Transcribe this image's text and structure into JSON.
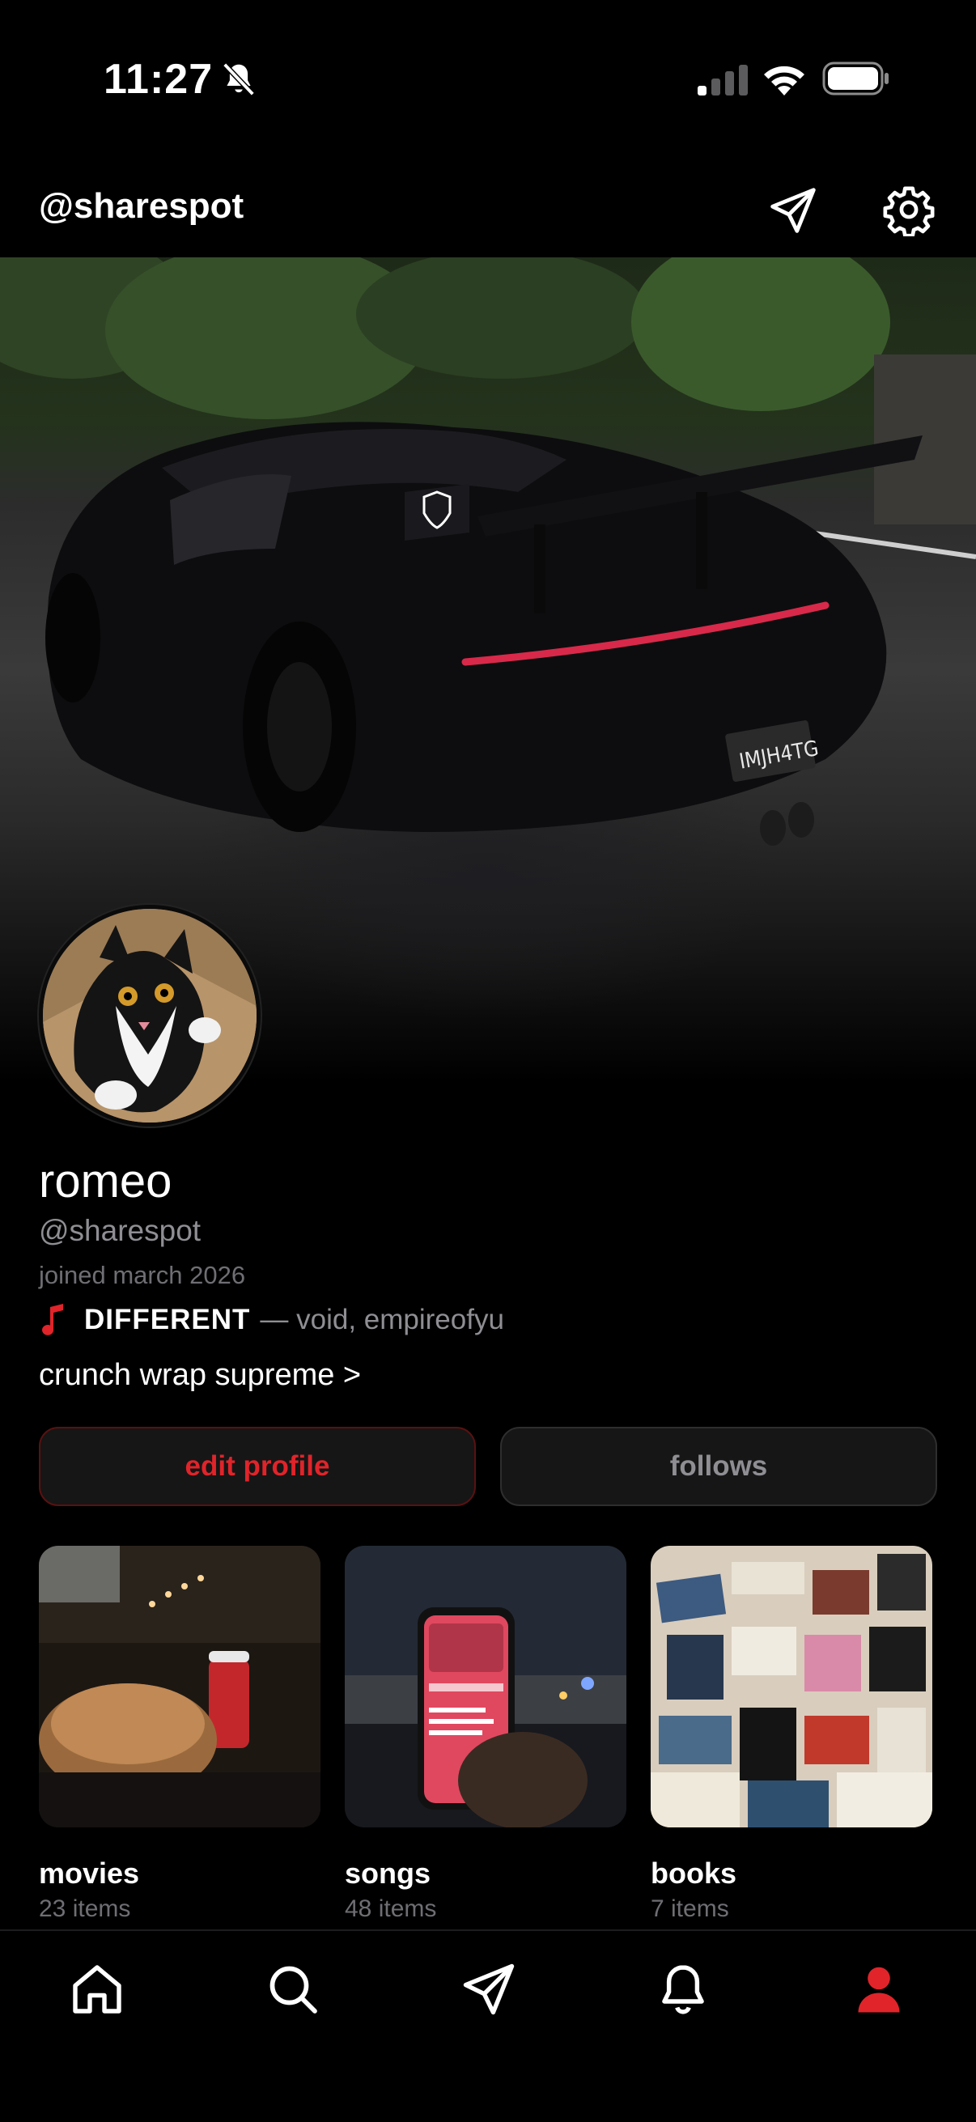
{
  "status_bar": {
    "time": "11:27",
    "icons": [
      "bell-slash-icon",
      "cellular-signal-icon",
      "wifi-icon",
      "battery-icon"
    ]
  },
  "header": {
    "title": "@sharespot",
    "icons": [
      "send-icon",
      "gear-icon"
    ]
  },
  "profile": {
    "name": "romeo",
    "handle": "@sharespot",
    "joined": "joined march 2026",
    "now_playing": {
      "icon": "music-note-icon",
      "song": "DIFFERENT",
      "artist": "— void, empireofyu"
    },
    "bio_link": "crunch wrap supreme >"
  },
  "actions": {
    "edit_profile": "edit profile",
    "follows": "follows"
  },
  "collections": [
    {
      "title": "movies",
      "count": "23 items"
    },
    {
      "title": "songs",
      "count": "48 items"
    },
    {
      "title": "books",
      "count": "7 items"
    }
  ],
  "tab_bar": {
    "items": [
      "home-icon",
      "search-icon",
      "send-icon",
      "bell-icon",
      "profile-icon"
    ],
    "active": "profile-icon"
  },
  "colors": {
    "accent": "#e0242a",
    "background": "#000000",
    "secondary_text": "#8e8e93",
    "button_bg": "#161616"
  }
}
